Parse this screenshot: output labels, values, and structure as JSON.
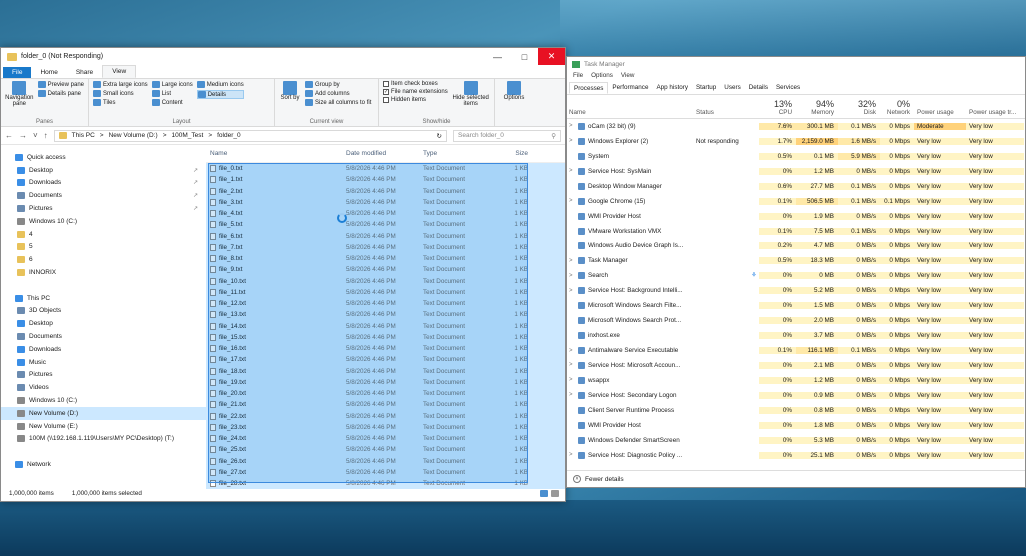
{
  "explorer": {
    "title": "folder_0 (Not Responding)",
    "tabs": [
      "File",
      "Home",
      "Share",
      "View"
    ],
    "ribbon": {
      "panes": {
        "nav_pane": "Navigation pane",
        "preview_pane": "Preview pane",
        "details_pane": "Details pane",
        "group": "Panes"
      },
      "layout": {
        "extra_large": "Extra large icons",
        "large": "Large icons",
        "medium": "Medium icons",
        "small": "Small icons",
        "list": "List",
        "details": "Details",
        "tiles": "Tiles",
        "content": "Content",
        "group": "Layout"
      },
      "current_view": {
        "sort_by": "Sort by",
        "group_by": "Group by",
        "add_columns": "Add columns",
        "size_all": "Size all columns to fit",
        "group": "Current view"
      },
      "show_hide": {
        "item_checkboxes": "Item check boxes",
        "file_ext": "File name extensions",
        "hidden_items": "Hidden items",
        "hide_selected": "Hide selected items",
        "group": "Show/hide"
      },
      "options": "Options"
    },
    "address": {
      "path": [
        "This PC",
        "New Volume (D:)",
        "100M_Test",
        "folder_0"
      ],
      "search_placeholder": "Search folder_0"
    },
    "nav": [
      {
        "label": "Quick access",
        "icon": "star-icon",
        "color": "#3a8ee6",
        "level": 0,
        "pinned": false
      },
      {
        "label": "Desktop",
        "icon": "desktop-icon",
        "color": "#3a8ee6",
        "level": 1,
        "pinned": true
      },
      {
        "label": "Downloads",
        "icon": "download-icon",
        "color": "#3a8ee6",
        "level": 1,
        "pinned": true
      },
      {
        "label": "Documents",
        "icon": "documents-icon",
        "color": "#6b8bb0",
        "level": 1,
        "pinned": true
      },
      {
        "label": "Pictures",
        "icon": "pictures-icon",
        "color": "#6b8bb0",
        "level": 1,
        "pinned": true
      },
      {
        "label": "Windows 10  (C:)",
        "icon": "drive-icon",
        "color": "#888888",
        "level": 1,
        "pinned": false
      },
      {
        "label": "4",
        "icon": "folder-icon",
        "color": "#e8c25a",
        "level": 1,
        "pinned": false
      },
      {
        "label": "5",
        "icon": "folder-icon",
        "color": "#e8c25a",
        "level": 1,
        "pinned": false
      },
      {
        "label": "6",
        "icon": "folder-icon",
        "color": "#e8c25a",
        "level": 1,
        "pinned": false
      },
      {
        "label": "INNORIX",
        "icon": "folder-icon",
        "color": "#e8c25a",
        "level": 1,
        "pinned": false
      },
      {
        "label": "",
        "icon": "",
        "color": "",
        "level": 1,
        "pinned": false
      },
      {
        "label": "This PC",
        "icon": "pc-icon",
        "color": "#3a8ee6",
        "level": 0,
        "pinned": false
      },
      {
        "label": "3D Objects",
        "icon": "cube-icon",
        "color": "#6b8bb0",
        "level": 1,
        "pinned": false
      },
      {
        "label": "Desktop",
        "icon": "desktop-icon",
        "color": "#3a8ee6",
        "level": 1,
        "pinned": false
      },
      {
        "label": "Documents",
        "icon": "documents-icon",
        "color": "#6b8bb0",
        "level": 1,
        "pinned": false
      },
      {
        "label": "Downloads",
        "icon": "download-icon",
        "color": "#3a8ee6",
        "level": 1,
        "pinned": false
      },
      {
        "label": "Music",
        "icon": "music-icon",
        "color": "#3a8ee6",
        "level": 1,
        "pinned": false
      },
      {
        "label": "Pictures",
        "icon": "pictures-icon",
        "color": "#6b8bb0",
        "level": 1,
        "pinned": false
      },
      {
        "label": "Videos",
        "icon": "video-icon",
        "color": "#6b8bb0",
        "level": 1,
        "pinned": false
      },
      {
        "label": "Windows 10  (C:)",
        "icon": "drive-icon",
        "color": "#888888",
        "level": 1,
        "pinned": false
      },
      {
        "label": "New Volume (D:)",
        "icon": "drive-icon",
        "color": "#888888",
        "level": 1,
        "pinned": false,
        "selected": true
      },
      {
        "label": "New Volume (E:)",
        "icon": "drive-icon",
        "color": "#888888",
        "level": 1,
        "pinned": false
      },
      {
        "label": "100M (\\\\192.168.1.119\\Users\\MY PC\\Desktop) (T:)",
        "icon": "network-drive-icon",
        "color": "#888888",
        "level": 1,
        "pinned": false
      },
      {
        "label": "",
        "icon": "",
        "color": "",
        "level": 1,
        "pinned": false
      },
      {
        "label": "Network",
        "icon": "network-icon",
        "color": "#3a8ee6",
        "level": 0,
        "pinned": false
      }
    ],
    "columns": {
      "name": "Name",
      "date": "Date modified",
      "type": "Type",
      "size": "Size"
    },
    "files": [
      {
        "name": "file_0.txt",
        "date": "5/8/2026 4:46 PM",
        "type": "Text Document",
        "size": "1 KB"
      },
      {
        "name": "file_1.txt",
        "date": "5/8/2026 4:46 PM",
        "type": "Text Document",
        "size": "1 KB"
      },
      {
        "name": "file_2.txt",
        "date": "5/8/2026 4:46 PM",
        "type": "Text Document",
        "size": "1 KB"
      },
      {
        "name": "file_3.txt",
        "date": "5/8/2026 4:46 PM",
        "type": "Text Document",
        "size": "1 KB"
      },
      {
        "name": "file_4.txt",
        "date": "5/8/2026 4:46 PM",
        "type": "Text Document",
        "size": "1 KB"
      },
      {
        "name": "file_5.txt",
        "date": "5/8/2026 4:46 PM",
        "type": "Text Document",
        "size": "1 KB"
      },
      {
        "name": "file_6.txt",
        "date": "5/8/2026 4:46 PM",
        "type": "Text Document",
        "size": "1 KB"
      },
      {
        "name": "file_7.txt",
        "date": "5/8/2026 4:46 PM",
        "type": "Text Document",
        "size": "1 KB"
      },
      {
        "name": "file_8.txt",
        "date": "5/8/2026 4:46 PM",
        "type": "Text Document",
        "size": "1 KB"
      },
      {
        "name": "file_9.txt",
        "date": "5/8/2026 4:46 PM",
        "type": "Text Document",
        "size": "1 KB"
      },
      {
        "name": "file_10.txt",
        "date": "5/8/2026 4:46 PM",
        "type": "Text Document",
        "size": "1 KB"
      },
      {
        "name": "file_11.txt",
        "date": "5/8/2026 4:46 PM",
        "type": "Text Document",
        "size": "1 KB"
      },
      {
        "name": "file_12.txt",
        "date": "5/8/2026 4:46 PM",
        "type": "Text Document",
        "size": "1 KB"
      },
      {
        "name": "file_13.txt",
        "date": "5/8/2026 4:46 PM",
        "type": "Text Document",
        "size": "1 KB"
      },
      {
        "name": "file_14.txt",
        "date": "5/8/2026 4:46 PM",
        "type": "Text Document",
        "size": "1 KB"
      },
      {
        "name": "file_15.txt",
        "date": "5/8/2026 4:46 PM",
        "type": "Text Document",
        "size": "1 KB"
      },
      {
        "name": "file_16.txt",
        "date": "5/8/2026 4:46 PM",
        "type": "Text Document",
        "size": "1 KB"
      },
      {
        "name": "file_17.txt",
        "date": "5/8/2026 4:46 PM",
        "type": "Text Document",
        "size": "1 KB"
      },
      {
        "name": "file_18.txt",
        "date": "5/8/2026 4:46 PM",
        "type": "Text Document",
        "size": "1 KB"
      },
      {
        "name": "file_19.txt",
        "date": "5/8/2026 4:46 PM",
        "type": "Text Document",
        "size": "1 KB"
      },
      {
        "name": "file_20.txt",
        "date": "5/8/2026 4:46 PM",
        "type": "Text Document",
        "size": "1 KB"
      },
      {
        "name": "file_21.txt",
        "date": "5/8/2026 4:46 PM",
        "type": "Text Document",
        "size": "1 KB"
      },
      {
        "name": "file_22.txt",
        "date": "5/8/2026 4:46 PM",
        "type": "Text Document",
        "size": "1 KB"
      },
      {
        "name": "file_23.txt",
        "date": "5/8/2026 4:46 PM",
        "type": "Text Document",
        "size": "1 KB"
      },
      {
        "name": "file_24.txt",
        "date": "5/8/2026 4:46 PM",
        "type": "Text Document",
        "size": "1 KB"
      },
      {
        "name": "file_25.txt",
        "date": "5/8/2026 4:46 PM",
        "type": "Text Document",
        "size": "1 KB"
      },
      {
        "name": "file_26.txt",
        "date": "5/8/2026 4:46 PM",
        "type": "Text Document",
        "size": "1 KB"
      },
      {
        "name": "file_27.txt",
        "date": "5/8/2026 4:46 PM",
        "type": "Text Document",
        "size": "1 KB"
      },
      {
        "name": "file_28.txt",
        "date": "5/8/2026 4:46 PM",
        "type": "Text Document",
        "size": "1 KB"
      }
    ],
    "status": {
      "items": "1,000,000 items",
      "selected": "1,000,000 items selected"
    }
  },
  "taskmanager": {
    "title": "Task Manager",
    "menu": [
      "File",
      "Options",
      "View"
    ],
    "tabs": [
      "Processes",
      "Performance",
      "App history",
      "Startup",
      "Users",
      "Details",
      "Services"
    ],
    "headers": {
      "name": "Name",
      "status": "Status",
      "cpu_pct": "13%",
      "cpu": "CPU",
      "mem_pct": "94%",
      "mem": "Memory",
      "disk_pct": "32%",
      "disk": "Disk",
      "net_pct": "0%",
      "net": "Network",
      "power": "Power usage",
      "power_trend": "Power usage tr..."
    },
    "processes": [
      {
        "name": "oCam (32 bit) (9)",
        "status": "",
        "cpu": "7.6%",
        "mem": "300.1 MB",
        "disk": "0.1 MB/s",
        "net": "0 Mbps",
        "power": "Moderate",
        "trend": "Very low",
        "expand": true,
        "icon": "ocam-icon"
      },
      {
        "name": "Windows Explorer (2)",
        "status": "Not responding",
        "cpu": "1.7%",
        "mem": "2,159.0 MB",
        "disk": "1.6 MB/s",
        "net": "0 Mbps",
        "power": "Very low",
        "trend": "Very low",
        "expand": true,
        "icon": "folder-icon"
      },
      {
        "name": "System",
        "status": "",
        "cpu": "0.5%",
        "mem": "0.1 MB",
        "disk": "5.9 MB/s",
        "net": "0 Mbps",
        "power": "Very low",
        "trend": "Very low",
        "expand": false,
        "icon": "system-icon"
      },
      {
        "name": "Service Host: SysMain",
        "status": "",
        "cpu": "0%",
        "mem": "1.2 MB",
        "disk": "0 MB/s",
        "net": "0 Mbps",
        "power": "Very low",
        "trend": "Very low",
        "expand": true,
        "icon": "gear-icon"
      },
      {
        "name": "Desktop Window Manager",
        "status": "",
        "cpu": "0.6%",
        "mem": "27.7 MB",
        "disk": "0.1 MB/s",
        "net": "0 Mbps",
        "power": "Very low",
        "trend": "Very low",
        "expand": false,
        "icon": "window-icon"
      },
      {
        "name": "Google Chrome (15)",
        "status": "",
        "cpu": "0.1%",
        "mem": "506.5 MB",
        "disk": "0.1 MB/s",
        "net": "0.1 Mbps",
        "power": "Very low",
        "trend": "Very low",
        "expand": true,
        "icon": "chrome-icon"
      },
      {
        "name": "WMI Provider Host",
        "status": "",
        "cpu": "0%",
        "mem": "1.9 MB",
        "disk": "0 MB/s",
        "net": "0 Mbps",
        "power": "Very low",
        "trend": "Very low",
        "expand": false,
        "icon": "gear-icon"
      },
      {
        "name": "VMware Workstation VMX",
        "status": "",
        "cpu": "0.1%",
        "mem": "7.5 MB",
        "disk": "0.1 MB/s",
        "net": "0 Mbps",
        "power": "Very low",
        "trend": "Very low",
        "expand": false,
        "icon": "vmware-icon"
      },
      {
        "name": "Windows Audio Device Graph Is...",
        "status": "",
        "cpu": "0.2%",
        "mem": "4.7 MB",
        "disk": "0 MB/s",
        "net": "0 Mbps",
        "power": "Very low",
        "trend": "Very low",
        "expand": false,
        "icon": "audio-icon"
      },
      {
        "name": "Task Manager",
        "status": "",
        "cpu": "0.5%",
        "mem": "18.3 MB",
        "disk": "0 MB/s",
        "net": "0 Mbps",
        "power": "Very low",
        "trend": "Very low",
        "expand": true,
        "icon": "taskmanager-icon"
      },
      {
        "name": "Search",
        "status": "",
        "cpu": "0%",
        "mem": "0 MB",
        "disk": "0 MB/s",
        "net": "0 Mbps",
        "power": "Very low",
        "trend": "Very low",
        "expand": true,
        "icon": "search-icon",
        "suspended": true
      },
      {
        "name": "Service Host: Background Intelli...",
        "status": "",
        "cpu": "0%",
        "mem": "5.2 MB",
        "disk": "0 MB/s",
        "net": "0 Mbps",
        "power": "Very low",
        "trend": "Very low",
        "expand": true,
        "icon": "gear-icon"
      },
      {
        "name": "Microsoft Windows Search Filte...",
        "status": "",
        "cpu": "0%",
        "mem": "1.5 MB",
        "disk": "0 MB/s",
        "net": "0 Mbps",
        "power": "Very low",
        "trend": "Very low",
        "expand": false,
        "icon": "search-icon"
      },
      {
        "name": "Microsoft Windows Search Prot...",
        "status": "",
        "cpu": "0%",
        "mem": "2.0 MB",
        "disk": "0 MB/s",
        "net": "0 Mbps",
        "power": "Very low",
        "trend": "Very low",
        "expand": false,
        "icon": "search-icon"
      },
      {
        "name": "inxhost.exe",
        "status": "",
        "cpu": "0%",
        "mem": "3.7 MB",
        "disk": "0 MB/s",
        "net": "0 Mbps",
        "power": "Very low",
        "trend": "Very low",
        "expand": false,
        "icon": "app-icon"
      },
      {
        "name": "Antimalware Service Executable",
        "status": "",
        "cpu": "0.1%",
        "mem": "116.1 MB",
        "disk": "0.1 MB/s",
        "net": "0 Mbps",
        "power": "Very low",
        "trend": "Very low",
        "expand": true,
        "icon": "shield-icon"
      },
      {
        "name": "Service Host: Microsoft Accoun...",
        "status": "",
        "cpu": "0%",
        "mem": "2.1 MB",
        "disk": "0 MB/s",
        "net": "0 Mbps",
        "power": "Very low",
        "trend": "Very low",
        "expand": true,
        "icon": "gear-icon"
      },
      {
        "name": "wsappx",
        "status": "",
        "cpu": "0%",
        "mem": "1.2 MB",
        "disk": "0 MB/s",
        "net": "0 Mbps",
        "power": "Very low",
        "trend": "Very low",
        "expand": true,
        "icon": "gear-icon"
      },
      {
        "name": "Service Host: Secondary Logon",
        "status": "",
        "cpu": "0%",
        "mem": "0.9 MB",
        "disk": "0 MB/s",
        "net": "0 Mbps",
        "power": "Very low",
        "trend": "Very low",
        "expand": true,
        "icon": "gear-icon"
      },
      {
        "name": "Client Server Runtime Process",
        "status": "",
        "cpu": "0%",
        "mem": "0.8 MB",
        "disk": "0 MB/s",
        "net": "0 Mbps",
        "power": "Very low",
        "trend": "Very low",
        "expand": false,
        "icon": "window-icon"
      },
      {
        "name": "WMI Provider Host",
        "status": "",
        "cpu": "0%",
        "mem": "1.8 MB",
        "disk": "0 MB/s",
        "net": "0 Mbps",
        "power": "Very low",
        "trend": "Very low",
        "expand": false,
        "icon": "gear-icon"
      },
      {
        "name": "Windows Defender SmartScreen",
        "status": "",
        "cpu": "0%",
        "mem": "5.3 MB",
        "disk": "0 MB/s",
        "net": "0 Mbps",
        "power": "Very low",
        "trend": "Very low",
        "expand": false,
        "icon": "shield-icon"
      },
      {
        "name": "Service Host: Diagnostic Policy ...",
        "status": "",
        "cpu": "0%",
        "mem": "25.1 MB",
        "disk": "0 MB/s",
        "net": "0 Mbps",
        "power": "Very low",
        "trend": "Very low",
        "expand": true,
        "icon": "gear-icon"
      }
    ],
    "fewer_details": "Fewer details"
  }
}
